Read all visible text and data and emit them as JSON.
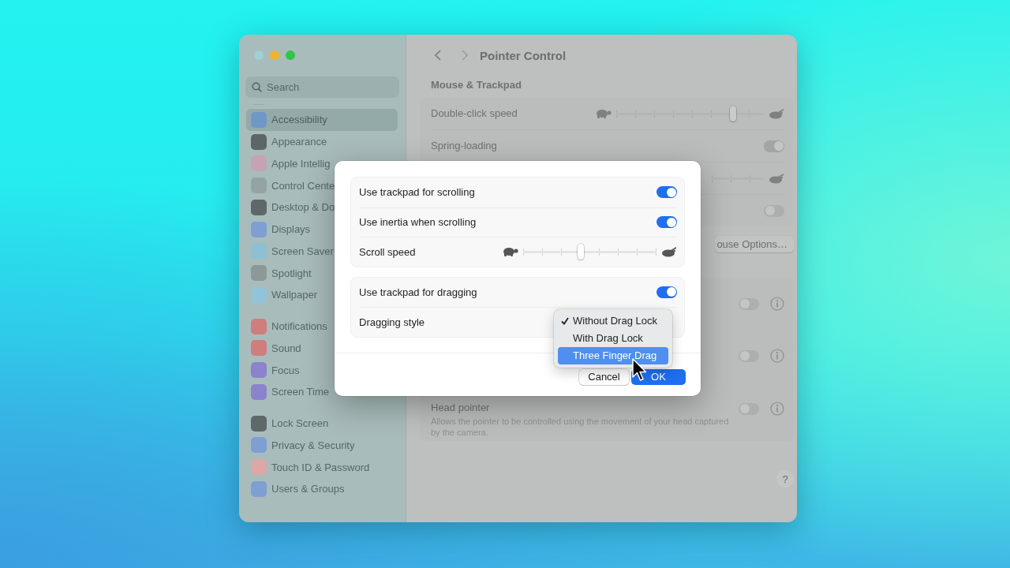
{
  "sidebar": {
    "search": {
      "placeholder": "Search"
    },
    "groups": [
      {
        "items": [
          {
            "label": "Accessibility",
            "selected": true,
            "color": "#6f98c8"
          },
          {
            "label": "Appearance",
            "selected": false,
            "color": "#5d6666"
          },
          {
            "label": "Apple Intellig",
            "selected": false,
            "color": "#c6a3b4"
          },
          {
            "label": "Control Cente",
            "selected": false,
            "color": "#94a3a3"
          },
          {
            "label": "Desktop & Do",
            "selected": false,
            "color": "#5f6868"
          },
          {
            "label": "Displays",
            "selected": false,
            "color": "#7f9fd2"
          },
          {
            "label": "Screen Saver",
            "selected": false,
            "color": "#8ec0d4"
          },
          {
            "label": "Spotlight",
            "selected": false,
            "color": "#8d9999"
          },
          {
            "label": "Wallpaper",
            "selected": false,
            "color": "#93c3d8"
          }
        ]
      },
      {
        "items": [
          {
            "label": "Notifications",
            "selected": false,
            "color": "#cf7d7d"
          },
          {
            "label": "Sound",
            "selected": false,
            "color": "#cf7d7d"
          },
          {
            "label": "Focus",
            "selected": false,
            "color": "#8b83cc"
          },
          {
            "label": "Screen Time",
            "selected": false,
            "color": "#8b83cc"
          }
        ]
      },
      {
        "items": [
          {
            "label": "Lock Screen",
            "selected": false,
            "color": "#5f6868"
          },
          {
            "label": "Privacy & Security",
            "selected": false,
            "color": "#7f9fd2"
          },
          {
            "label": "Touch ID & Password",
            "selected": false,
            "color": "#dba7a7"
          },
          {
            "label": "Users & Groups",
            "selected": false,
            "color": "#7f9fd2"
          }
        ]
      }
    ]
  },
  "panel": {
    "title": "Pointer Control",
    "section": "Mouse & Trackpad",
    "rows": [
      {
        "kind": "slider",
        "label": "Double-click speed",
        "level": 0.79
      },
      {
        "kind": "toggle",
        "label": "Spring-loading",
        "on": true
      },
      {
        "kind": "slider"
      },
      {
        "kind": "toggle",
        "on": false
      }
    ],
    "options_button": "ouse Options…",
    "rows2": [
      {
        "kind": "toggle",
        "on": false,
        "info": true
      },
      {
        "kind": "toggle",
        "on": false,
        "info": true
      },
      {
        "kind": "toggle",
        "label": "Head pointer",
        "description": "Allows the pointer to be controlled using the movement of your head captured by the camera.",
        "on": false,
        "info": true
      }
    ],
    "help_button": "?"
  },
  "dialog": {
    "groups": [
      {
        "rows": [
          {
            "kind": "toggle",
            "label": "Use trackpad for scrolling",
            "on": true
          },
          {
            "kind": "toggle",
            "label": "Use inertia when scrolling",
            "on": true
          },
          {
            "kind": "slider",
            "label": "Scroll speed",
            "level": 0.43
          }
        ]
      },
      {
        "rows": [
          {
            "kind": "toggle",
            "label": "Use trackpad for dragging",
            "on": true
          },
          {
            "kind": "popup",
            "label": "Dragging style",
            "menu": [
              {
                "label": "Without Drag Lock",
                "checked": true,
                "highlighted": false
              },
              {
                "label": "With Drag Lock",
                "checked": false,
                "highlighted": false
              },
              {
                "label": "Three Finger Drag",
                "checked": false,
                "highlighted": true
              }
            ]
          }
        ]
      }
    ],
    "buttons": [
      {
        "label": "Cancel",
        "default": false
      },
      {
        "label": "OK",
        "default": true
      }
    ]
  }
}
